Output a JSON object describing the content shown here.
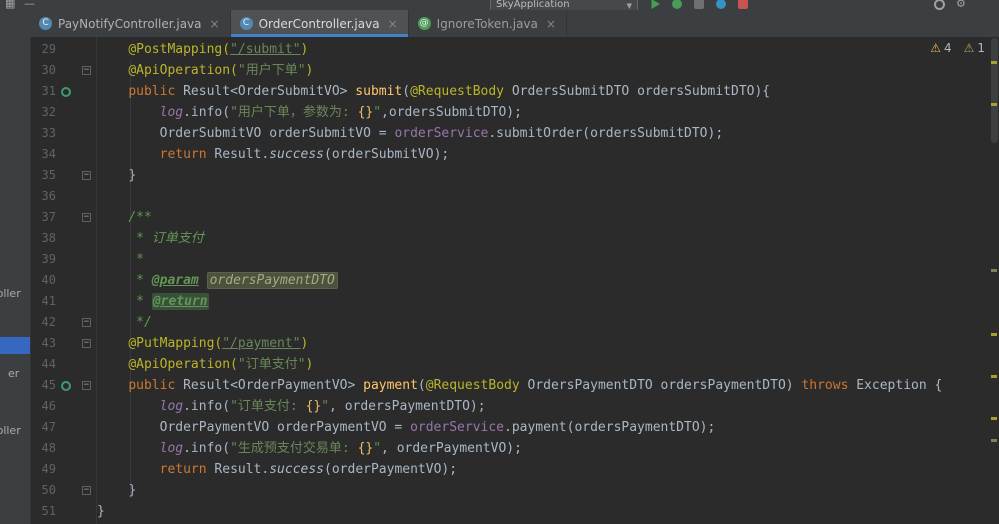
{
  "titlebar": {
    "run_config": "SkyApplication"
  },
  "icons": {
    "close": "×",
    "warning": "⚠",
    "fold_collapse": "−",
    "grid": "▦",
    "dash": "—",
    "combo_arrow": "▼",
    "settings_gear": "⚙"
  },
  "colors": {
    "active_tab_underline": "#4083C9",
    "selection_blue": "#3667C1",
    "annotation": "#BBB529",
    "keyword": "#CC7832",
    "string": "#6A8759"
  },
  "tabs": [
    {
      "label": "PayNotifyController.java",
      "type": "class",
      "icon_letter": "C",
      "active": false
    },
    {
      "label": "OrderController.java",
      "type": "class",
      "icon_letter": "C",
      "active": true
    },
    {
      "label": "IgnoreToken.java",
      "type": "annotation",
      "icon_letter": "@",
      "active": false
    }
  ],
  "project_panel": {
    "items": [
      {
        "label": "troller"
      },
      {
        "label": "er"
      },
      {
        "label": "troller"
      }
    ]
  },
  "inspections": {
    "warnings": "4",
    "weak_warnings": "1"
  },
  "editor": {
    "lines": [
      {
        "n": 29,
        "ind": 4,
        "seg": [
          [
            "ann",
            "@PostMapping("
          ],
          [
            "strlink",
            "\"/submit\""
          ],
          [
            "ann",
            ")"
          ]
        ]
      },
      {
        "n": 30,
        "ind": 4,
        "fold": true,
        "seg": [
          [
            "ann",
            "@ApiOperation("
          ],
          [
            "str",
            "\"用户下单\""
          ],
          [
            "ann",
            ")"
          ]
        ]
      },
      {
        "n": 31,
        "ind": 4,
        "icon": true,
        "seg": [
          [
            "kw",
            "public "
          ],
          [
            "p",
            "Result<OrderSubmitVO> "
          ],
          [
            "m",
            "submit"
          ],
          [
            "p",
            "("
          ],
          [
            "ann",
            "@RequestBody "
          ],
          [
            "p",
            "OrdersSubmitDTO ordersSubmitDTO){"
          ]
        ]
      },
      {
        "n": 32,
        "ind": 8,
        "seg": [
          [
            "sfld",
            "log"
          ],
          [
            "p",
            ".info("
          ],
          [
            "str",
            "\"用户下单，参数为: "
          ],
          [
            "ph",
            "{}"
          ],
          [
            "str",
            "\""
          ],
          [
            "p",
            ",ordersSubmitDTO);"
          ]
        ]
      },
      {
        "n": 33,
        "ind": 8,
        "seg": [
          [
            "p",
            "OrderSubmitVO orderSubmitVO = "
          ],
          [
            "fld",
            "orderService"
          ],
          [
            "p",
            ".submitOrder(ordersSubmitDTO);"
          ]
        ]
      },
      {
        "n": 34,
        "ind": 8,
        "seg": [
          [
            "kw",
            "return "
          ],
          [
            "p",
            "Result."
          ],
          [
            "sm",
            "success"
          ],
          [
            "p",
            "(orderSubmitVO);"
          ]
        ]
      },
      {
        "n": 35,
        "ind": 4,
        "fold": true,
        "seg": [
          [
            "p",
            "}"
          ]
        ]
      },
      {
        "n": 36,
        "ind": 0,
        "seg": []
      },
      {
        "n": 37,
        "ind": 4,
        "fold": true,
        "seg": [
          [
            "doc",
            "/**"
          ]
        ]
      },
      {
        "n": 38,
        "ind": 4,
        "seg": [
          [
            "doc",
            " * 订单支付"
          ]
        ]
      },
      {
        "n": 39,
        "ind": 4,
        "seg": [
          [
            "doc",
            " *"
          ]
        ]
      },
      {
        "n": 40,
        "ind": 4,
        "seg": [
          [
            "doc",
            " * "
          ],
          [
            "dt",
            "@param"
          ],
          [
            "doc",
            " "
          ],
          [
            "dv",
            "ordersPaymentDTO"
          ]
        ]
      },
      {
        "n": 41,
        "ind": 4,
        "seg": [
          [
            "doc",
            " * "
          ],
          [
            "dth",
            "@return"
          ]
        ]
      },
      {
        "n": 42,
        "ind": 4,
        "fold": true,
        "seg": [
          [
            "doc",
            " */"
          ]
        ]
      },
      {
        "n": 43,
        "ind": 4,
        "fold": true,
        "seg": [
          [
            "ann",
            "@PutMapping("
          ],
          [
            "strlink",
            "\"/payment\""
          ],
          [
            "ann",
            ")"
          ]
        ]
      },
      {
        "n": 44,
        "ind": 4,
        "seg": [
          [
            "ann",
            "@ApiOperation("
          ],
          [
            "str",
            "\"订单支付\""
          ],
          [
            "ann",
            ")"
          ]
        ]
      },
      {
        "n": 45,
        "ind": 4,
        "fold": true,
        "icon": true,
        "seg": [
          [
            "kw",
            "public "
          ],
          [
            "p",
            "Result<OrderPaymentVO> "
          ],
          [
            "m",
            "payment"
          ],
          [
            "p",
            "("
          ],
          [
            "ann",
            "@RequestBody "
          ],
          [
            "p",
            "OrdersPaymentDTO ordersPaymentDTO) "
          ],
          [
            "kw",
            "throws "
          ],
          [
            "p",
            "Exception {"
          ]
        ]
      },
      {
        "n": 46,
        "ind": 8,
        "seg": [
          [
            "sfld",
            "log"
          ],
          [
            "p",
            ".info("
          ],
          [
            "str",
            "\"订单支付: "
          ],
          [
            "ph",
            "{}"
          ],
          [
            "str",
            "\""
          ],
          [
            "p",
            ", ordersPaymentDTO);"
          ]
        ]
      },
      {
        "n": 47,
        "ind": 8,
        "seg": [
          [
            "p",
            "OrderPaymentVO orderPaymentVO = "
          ],
          [
            "fld",
            "orderService"
          ],
          [
            "p",
            ".payment(ordersPaymentDTO);"
          ]
        ]
      },
      {
        "n": 48,
        "ind": 8,
        "seg": [
          [
            "sfld",
            "log"
          ],
          [
            "p",
            ".info("
          ],
          [
            "str",
            "\"生成预支付交易单: "
          ],
          [
            "ph",
            "{}"
          ],
          [
            "str",
            "\""
          ],
          [
            "p",
            ", orderPaymentVO);"
          ]
        ]
      },
      {
        "n": 49,
        "ind": 8,
        "seg": [
          [
            "kw",
            "return "
          ],
          [
            "p",
            "Result."
          ],
          [
            "sm",
            "success"
          ],
          [
            "p",
            "(orderPaymentVO);"
          ]
        ]
      },
      {
        "n": 50,
        "ind": 4,
        "fold": true,
        "seg": [
          [
            "p",
            "}"
          ]
        ]
      },
      {
        "n": 51,
        "ind": 0,
        "seg": [
          [
            "p",
            "}"
          ]
        ]
      }
    ]
  }
}
